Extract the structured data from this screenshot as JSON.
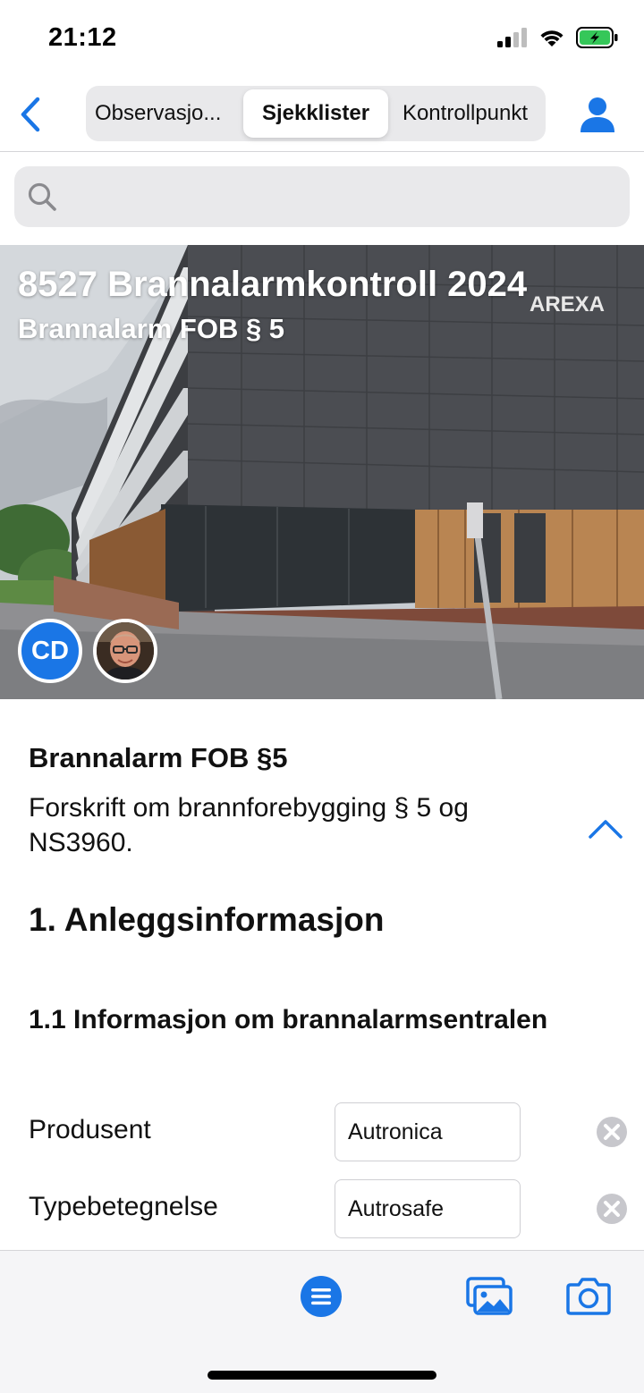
{
  "status": {
    "time": "21:12"
  },
  "nav": {
    "tabs": [
      {
        "label": "Observasjo..."
      },
      {
        "label": "Sjekklister"
      },
      {
        "label": "Kontrollpunkt"
      }
    ],
    "active_tab": "Sjekklister"
  },
  "search": {
    "placeholder": ""
  },
  "hero": {
    "title": "8527 Brannalarmkontroll 2024",
    "subtitle": "Brannalarm FOB § 5",
    "avatar_initials": "CD"
  },
  "checklist": {
    "title": "Brannalarm FOB §5",
    "description": "Forskrift om brannforebygging § 5 og NS3960.",
    "section_heading": "1. Anleggsinformasjon",
    "subsection_heading": "1.1 Informasjon om brannalarmsentralen",
    "fields": [
      {
        "label": "Produsent",
        "value": "Autronica"
      },
      {
        "label": "Typebetegnelse",
        "value": "Autrosafe"
      }
    ]
  },
  "colors": {
    "accent": "#1a76e6",
    "background": "#ffffff",
    "toolbar": "#f5f5f7"
  },
  "icons": {
    "back": "chevron-left-icon",
    "user": "person-icon",
    "search": "search-icon",
    "collapse": "chevron-up-icon",
    "clear": "clear-circle-icon",
    "menu": "list-menu-icon",
    "gallery": "photo-gallery-icon",
    "camera": "camera-icon"
  }
}
